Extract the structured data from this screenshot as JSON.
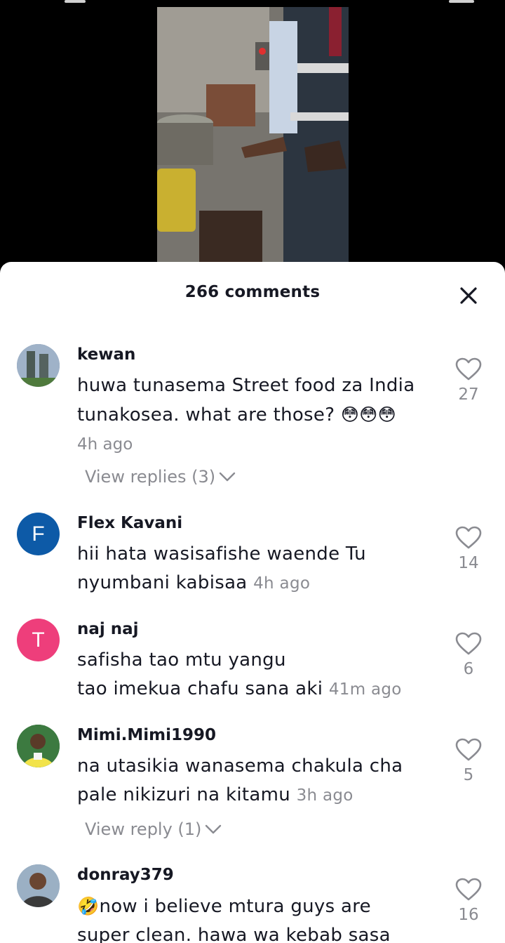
{
  "header": {
    "title": "266 comments"
  },
  "icons": {
    "close": "close-icon",
    "like": "heart-outline-icon",
    "chevron": "chevron-down-icon"
  },
  "colors": {
    "avatar_flex": "#0d5aa7",
    "avatar_naj": "#ee3e7b",
    "meta_gray": "#8a8b91"
  },
  "comments": [
    {
      "username": "kewan",
      "text": "huwa tunasema Street food za India tunakosea. what are those?",
      "emojis": "😳😳😳",
      "time": "4h ago",
      "likes": "27",
      "replies_label": "View replies (3)"
    },
    {
      "username": "Flex Kavani",
      "avatar_letter": "F",
      "text": "hii hata wasisafishe waende Tu nyumbani kabisaa",
      "time": "4h ago",
      "likes": "14"
    },
    {
      "username": "naj naj",
      "avatar_letter": "T",
      "text_line1": "safisha tao mtu yangu",
      "text_line2": "tao imekua chafu sana aki",
      "time": "41m ago",
      "likes": "6"
    },
    {
      "username": "Mimi.Mimi1990",
      "text": "na utasikia wanasema chakula cha pale nikizuri na kitamu",
      "time": "3h ago",
      "likes": "5",
      "replies_label": "View reply (1)"
    },
    {
      "username": "donray379",
      "emoji": "🤣",
      "text": "now i believe mtura guys are super clean. hawa wa kebab sasa",
      "likes": "16"
    }
  ]
}
